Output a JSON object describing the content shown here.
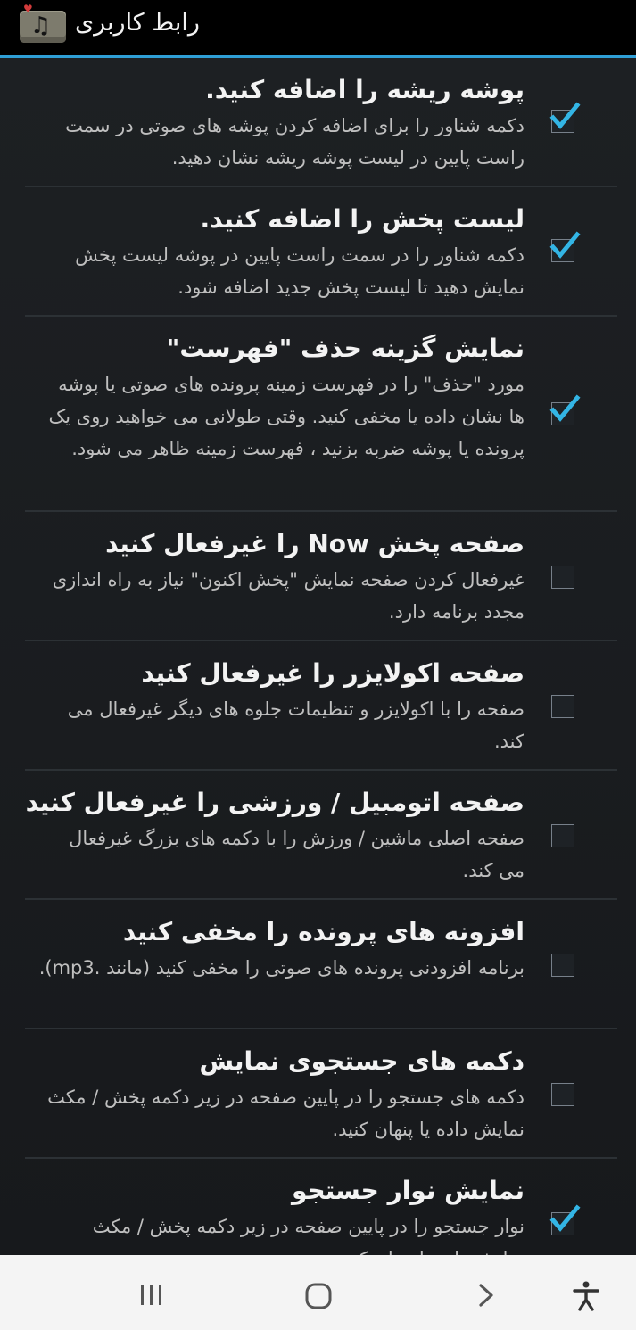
{
  "action_bar": {
    "title": "رابط کاربری",
    "icon": "music-note-icon"
  },
  "settings": [
    {
      "title": "پوشه ریشه را اضافه کنید.",
      "summary": "دکمه شناور را برای اضافه کردن پوشه های صوتی در سمت راست پایین در لیست پوشه ریشه نشان دهید.",
      "checked": true
    },
    {
      "title": "لیست پخش را اضافه کنید.",
      "summary": "دکمه شناور را در سمت راست پایین در پوشه لیست پخش نمایش دهید تا لیست پخش جدید اضافه شود.",
      "checked": true
    },
    {
      "title": "نمایش گزینه حذف \"فهرست\"",
      "summary": "مورد \"حذف\" را در فهرست زمینه پرونده های صوتی یا پوشه ها نشان داده یا مخفی کنید.  وقتی طولانی می خواهید روی یک پرونده یا پوشه ضربه بزنید ، فهرست زمینه ظاهر می شود.",
      "checked": true
    },
    {
      "title": "صفحه پخش Now را غیرفعال کنید",
      "summary": "غیرفعال کردن صفحه نمایش \"پخش اکنون\" نیاز به راه اندازی مجدد برنامه دارد.",
      "checked": false
    },
    {
      "title": "صفحه اکولایزر را غیرفعال کنید",
      "summary": "صفحه را با اکولایزر و تنظیمات جلوه های دیگر غیرفعال می کند.",
      "checked": false
    },
    {
      "title": "صفحه اتومبیل / ورزشی را غیرفعال کنید",
      "summary": "صفحه اصلی ماشین / ورزش را با دکمه های بزرگ غیرفعال می کند.",
      "checked": false
    },
    {
      "title": "افزونه های پرونده را مخفی کنید",
      "summary": "برنامه افزودنی پرونده های صوتی را مخفی کنید (مانند .mp3).",
      "checked": false
    },
    {
      "title": "دکمه های جستجوی نمایش",
      "summary": "دکمه های جستجو را در پایین صفحه در زیر دکمه پخش / مکث نمایش داده یا پنهان کنید.",
      "checked": false
    },
    {
      "title": "نمایش نوار جستجو",
      "summary": "نوار جستجو را در پایین صفحه در زیر دکمه پخش / مکث نمایش داده یا پنهان کنید.",
      "checked": true
    }
  ],
  "nav_bar": {
    "recents": "recents-icon",
    "home": "home-icon",
    "back": "back-icon",
    "accessibility": "accessibility-icon"
  },
  "colors": {
    "accent": "#2f9fd6",
    "check": "#33b5e5",
    "background": "#16191c",
    "nav_background": "#f4f4f4"
  }
}
